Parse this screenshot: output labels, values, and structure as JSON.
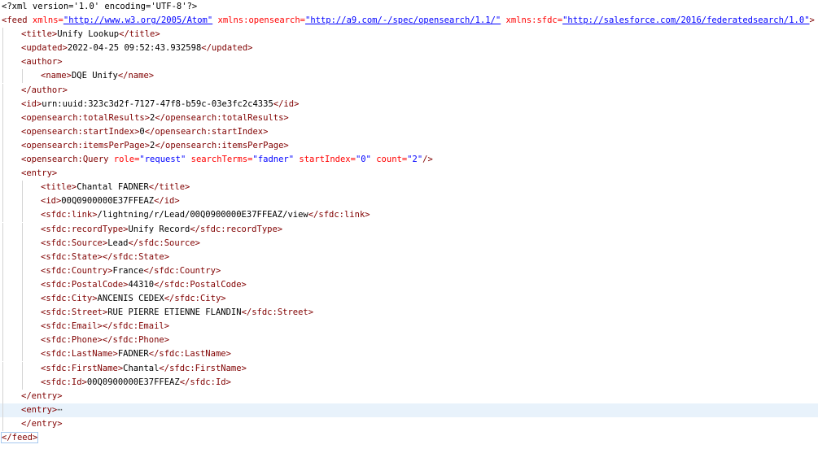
{
  "xml_declaration": "<?xml version='1.0' encoding='UTF-8'?>",
  "feed_open": {
    "tag": "<feed",
    "attrs": [
      {
        "name": " xmlns=",
        "value": "\"http://www.w3.org/2005/Atom\"",
        "link": true
      },
      {
        "name": " xmlns:opensearch=",
        "value": "\"http://a9.com/-/spec/opensearch/1.1/\"",
        "link": true
      },
      {
        "name": " xmlns:sfdc=",
        "value": "\"http://salesforce.com/2016/federatedsearch/1.0\"",
        "link": true
      }
    ],
    "close": ">"
  },
  "lines": [
    {
      "indent": 1,
      "open": "<title>",
      "text": "Unify Lookup",
      "close": "</title>"
    },
    {
      "indent": 1,
      "open": "<updated>",
      "text": "2022-04-25 09:52:43.932598",
      "close": "</updated>"
    },
    {
      "indent": 1,
      "open": "<author>",
      "text": "",
      "close": ""
    },
    {
      "indent": 2,
      "open": "<name>",
      "text": "DQE Unify",
      "close": "</name>"
    },
    {
      "indent": 1,
      "open": "</author>",
      "text": "",
      "close": ""
    },
    {
      "indent": 1,
      "open": "<id>",
      "text": "urn:uuid:323c3d2f-7127-47f8-b59c-03e3fc2c4335",
      "close": "</id>"
    },
    {
      "indent": 1,
      "open": "<opensearch:totalResults>",
      "text": "2",
      "close": "</opensearch:totalResults>"
    },
    {
      "indent": 1,
      "open": "<opensearch:startIndex>",
      "text": "0",
      "close": "</opensearch:startIndex>"
    },
    {
      "indent": 1,
      "open": "<opensearch:itemsPerPage>",
      "text": "2",
      "close": "</opensearch:itemsPerPage>"
    },
    {
      "indent": 1,
      "query": true
    },
    {
      "indent": 1,
      "open": "<entry>",
      "text": "",
      "close": ""
    },
    {
      "indent": 2,
      "open": "<title>",
      "text": "Chantal FADNER",
      "close": "</title>"
    },
    {
      "indent": 2,
      "open": "<id>",
      "text": "00Q0900000E37FFEAZ",
      "close": "</id>"
    },
    {
      "indent": 2,
      "open": "<sfdc:link>",
      "text": "/lightning/r/Lead/00Q0900000E37FFEAZ/view",
      "close": "</sfdc:link>"
    },
    {
      "indent": 2,
      "open": "<sfdc:recordType>",
      "text": "Unify Record",
      "close": "</sfdc:recordType>"
    },
    {
      "indent": 2,
      "open": "<sfdc:Source>",
      "text": "Lead",
      "close": "</sfdc:Source>"
    },
    {
      "indent": 2,
      "open": "<sfdc:State>",
      "text": "",
      "close": "</sfdc:State>"
    },
    {
      "indent": 2,
      "open": "<sfdc:Country>",
      "text": "France",
      "close": "</sfdc:Country>"
    },
    {
      "indent": 2,
      "open": "<sfdc:PostalCode>",
      "text": "44310",
      "close": "</sfdc:PostalCode>"
    },
    {
      "indent": 2,
      "open": "<sfdc:City>",
      "text": "ANCENIS CEDEX",
      "close": "</sfdc:City>"
    },
    {
      "indent": 2,
      "open": "<sfdc:Street>",
      "text": "RUE PIERRE ETIENNE FLANDIN",
      "close": "</sfdc:Street>"
    },
    {
      "indent": 2,
      "open": "<sfdc:Email>",
      "text": "",
      "close": "</sfdc:Email>"
    },
    {
      "indent": 2,
      "open": "<sfdc:Phone>",
      "text": "",
      "close": "</sfdc:Phone>"
    },
    {
      "indent": 2,
      "open": "<sfdc:LastName>",
      "text": "FADNER",
      "close": "</sfdc:LastName>"
    },
    {
      "indent": 2,
      "open": "<sfdc:FirstName>",
      "text": "Chantal",
      "close": "</sfdc:FirstName>"
    },
    {
      "indent": 2,
      "open": "<sfdc:Id>",
      "text": "00Q0900000E37FFEAZ",
      "close": "</sfdc:Id>"
    },
    {
      "indent": 1,
      "open": "</entry>",
      "text": "",
      "close": ""
    },
    {
      "indent": 1,
      "open": "<entry>",
      "text": "",
      "close": "",
      "collapsed": true,
      "current": true
    },
    {
      "indent": 1,
      "open": "</entry>",
      "text": "",
      "close": ""
    },
    {
      "indent": 0,
      "open": "</feed>",
      "text": "",
      "close": "",
      "boxed": true
    }
  ],
  "query_line": {
    "tag": "<opensearch:Query",
    "attrs": [
      {
        "name": " role=",
        "value": "\"request\""
      },
      {
        "name": " searchTerms=",
        "value": "\"fadner\""
      },
      {
        "name": " startIndex=",
        "value": "\"0\""
      },
      {
        "name": " count=",
        "value": "\"2\""
      }
    ],
    "close": "/>"
  },
  "collapsed_marker": "⋯",
  "colors": {
    "tag": "#800000",
    "attribute": "#ff0000",
    "string": "#0000ff",
    "text": "#000000",
    "current_line": "#e8f2fb"
  }
}
